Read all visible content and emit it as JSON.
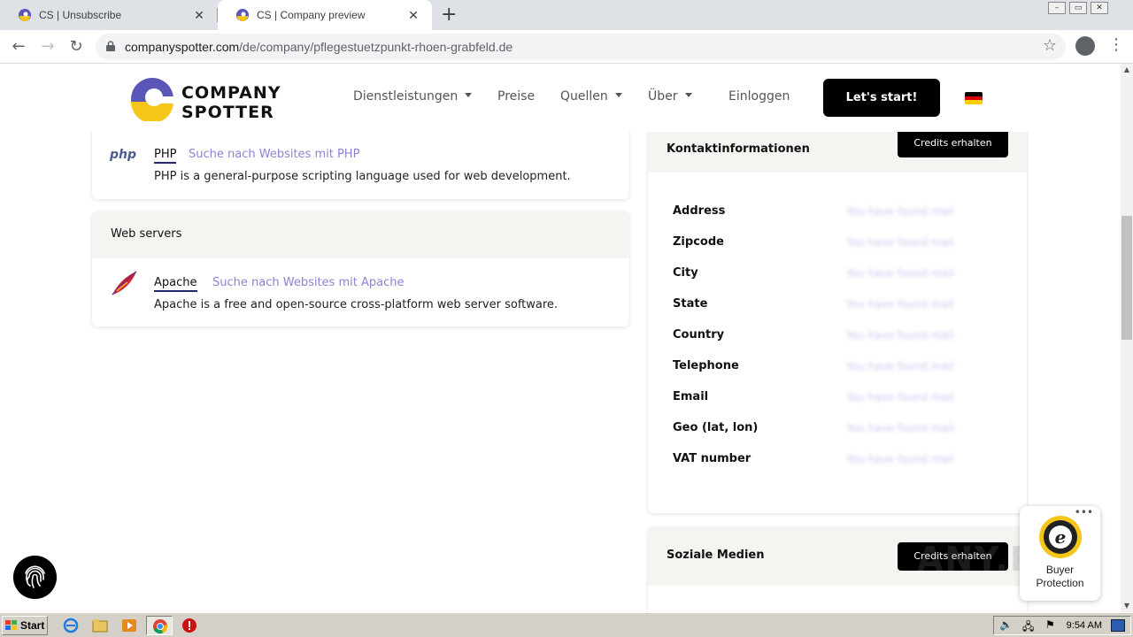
{
  "browser": {
    "tabs": [
      {
        "title": "CS | Unsubscribe",
        "active": false
      },
      {
        "title": "CS | Company preview",
        "active": true
      }
    ],
    "url_host": "companyspotter.com",
    "url_path": "/de/company/pflegestuetzpunkt-rhoen-grabfeld.de"
  },
  "header": {
    "logo_line1": "COMPANY",
    "logo_line2": "SPOTTER",
    "nav": {
      "services": "Dienstleistungen",
      "prices": "Preise",
      "sources": "Quellen",
      "about": "Über",
      "login": "Einloggen"
    },
    "cta": "Let's start!"
  },
  "technologies": {
    "php": {
      "logo_text": "php",
      "name": "PHP",
      "link": "Suche nach Websites mit PHP",
      "description": "PHP is a general-purpose scripting language used for web development."
    },
    "web_servers_title": "Web servers",
    "apache": {
      "name": "Apache",
      "link": "Suche nach Websites mit Apache",
      "description": "Apache is a free and open-source cross-platform web server software."
    }
  },
  "contact": {
    "title": "Kontaktinformationen",
    "button": "Credits erhalten",
    "fields": [
      {
        "label": "Address",
        "value": "You have found mail"
      },
      {
        "label": "Zipcode",
        "value": "You have found mail"
      },
      {
        "label": "City",
        "value": "You have found mail"
      },
      {
        "label": "State",
        "value": "You have found mail"
      },
      {
        "label": "Country",
        "value": "You have found mail"
      },
      {
        "label": "Telephone",
        "value": "You have found mail"
      },
      {
        "label": "Email",
        "value": "You have found mail"
      },
      {
        "label": "Geo (lat, lon)",
        "value": "You have found mail"
      },
      {
        "label": "VAT number",
        "value": "You have found mail"
      }
    ]
  },
  "social": {
    "title": "Soziale Medien",
    "button": "Credits erhalten"
  },
  "trusted_shops": {
    "line1": "Buyer",
    "line2": "Protection"
  },
  "watermark": "ANY.RUN",
  "taskbar": {
    "start": "Start",
    "clock": "9:54 AM"
  },
  "colors": {
    "accent_link": "#8a84d4",
    "cta_bg": "#000000",
    "card_header_bg": "#f6f4f1"
  }
}
